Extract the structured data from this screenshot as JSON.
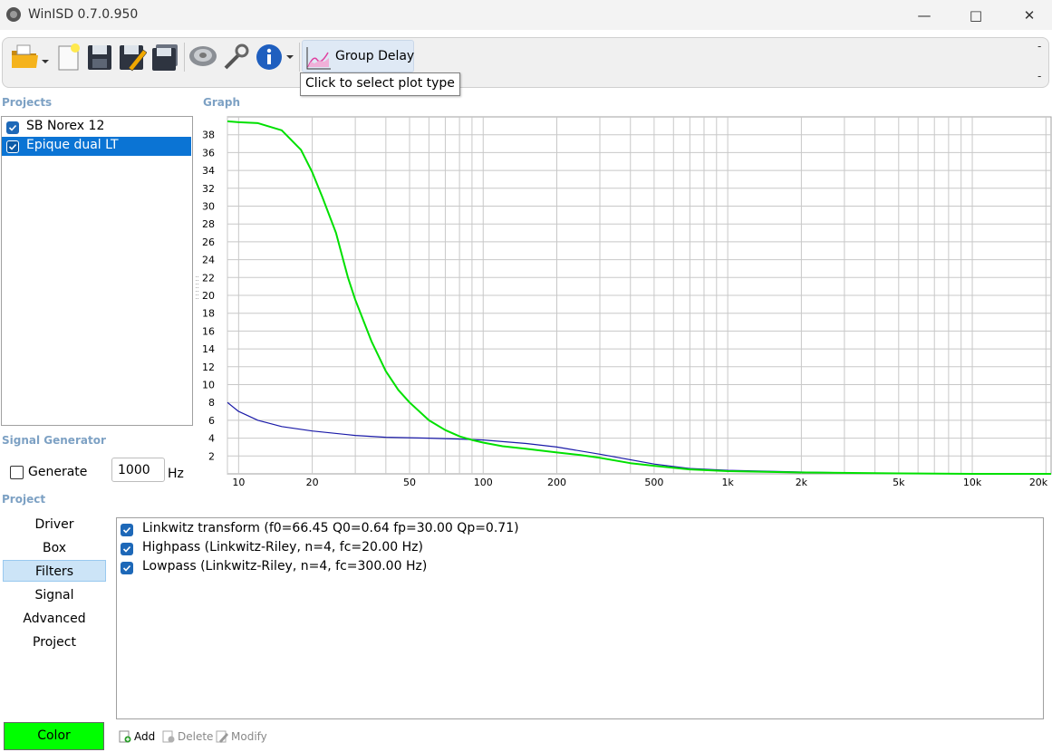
{
  "window": {
    "title": "WinISD 0.7.0.950"
  },
  "toolbar": {
    "icons": [
      "open-folder-icon",
      "new-document-icon",
      "save-icon",
      "save-as-icon",
      "save-all-icon",
      "driver-icon",
      "tools-icon",
      "info-icon",
      "plot-type-icon"
    ],
    "plot_type_label": "Group Delay",
    "tooltip": "Click to select plot type",
    "right_marks": [
      "-",
      "-"
    ]
  },
  "projects": {
    "heading": "Projects",
    "items": [
      {
        "label": "SB Norex 12",
        "checked": true,
        "selected": false
      },
      {
        "label": "Epique dual LT",
        "checked": true,
        "selected": true
      }
    ]
  },
  "graph": {
    "heading": "Graph"
  },
  "signal_generator": {
    "heading": "Signal Generator",
    "generate_label": "Generate",
    "generate_checked": false,
    "frequency_value": "1000",
    "unit": "Hz"
  },
  "project_nav": {
    "heading": "Project",
    "items": [
      "Driver",
      "Box",
      "Filters",
      "Signal",
      "Advanced",
      "Project"
    ],
    "selected": "Filters"
  },
  "filters": [
    {
      "label": "Linkwitz transform (f0=66.45 Q0=0.64 fp=30.00 Qp=0.71)",
      "checked": true
    },
    {
      "label": "Highpass (Linkwitz-Riley, n=4, fc=20.00 Hz)",
      "checked": true
    },
    {
      "label": "Lowpass (Linkwitz-Riley, n=4, fc=300.00 Hz)",
      "checked": true
    }
  ],
  "actions": {
    "add": "Add",
    "delete": "Delete",
    "modify": "Modify"
  },
  "color_button": {
    "label": "Color",
    "color": "#00ff00"
  },
  "chart_data": {
    "type": "line",
    "title": "",
    "xlabel": "",
    "ylabel": "",
    "x_scale": "log",
    "xlim": [
      9,
      21000
    ],
    "ylim": [
      0,
      40
    ],
    "grid": true,
    "x_tick_labels": [
      "10",
      "20",
      "50",
      "100",
      "200",
      "500",
      "1k",
      "2k",
      "5k",
      "10k",
      "20k"
    ],
    "x_tick_values": [
      10,
      20,
      50,
      100,
      200,
      500,
      1000,
      2000,
      5000,
      10000,
      20000
    ],
    "y_tick_labels": [
      "2",
      "4",
      "6",
      "8",
      "10",
      "12",
      "14",
      "16",
      "18",
      "20",
      "22",
      "24",
      "26",
      "28",
      "30",
      "32",
      "34",
      "36",
      "38"
    ],
    "series": [
      {
        "color": "#00e000",
        "x": [
          9,
          10,
          12,
          15,
          18,
          20,
          22,
          25,
          28,
          30,
          35,
          40,
          45,
          50,
          60,
          70,
          80,
          90,
          100,
          120,
          150,
          200,
          250,
          300,
          400,
          500,
          700,
          1000,
          2000,
          5000,
          10000,
          21000
        ],
        "y": [
          39.5,
          39.4,
          39.3,
          38.5,
          36.3,
          33.8,
          31.0,
          27.0,
          22.0,
          19.5,
          14.8,
          11.5,
          9.4,
          8.0,
          6.0,
          4.9,
          4.2,
          3.8,
          3.5,
          3.1,
          2.8,
          2.4,
          2.1,
          1.8,
          1.2,
          0.9,
          0.5,
          0.3,
          0.15,
          0.05,
          0.0,
          0.0
        ]
      },
      {
        "color": "#1a1aa8",
        "x": [
          9,
          10,
          12,
          15,
          20,
          30,
          40,
          60,
          80,
          100,
          150,
          200,
          300,
          500,
          700,
          1000,
          2000,
          3300
        ],
        "y": [
          8.0,
          7.0,
          6.0,
          5.3,
          4.8,
          4.3,
          4.1,
          4.0,
          3.9,
          3.8,
          3.4,
          3.0,
          2.2,
          1.1,
          0.6,
          0.4,
          0.2,
          0.1
        ]
      }
    ]
  }
}
